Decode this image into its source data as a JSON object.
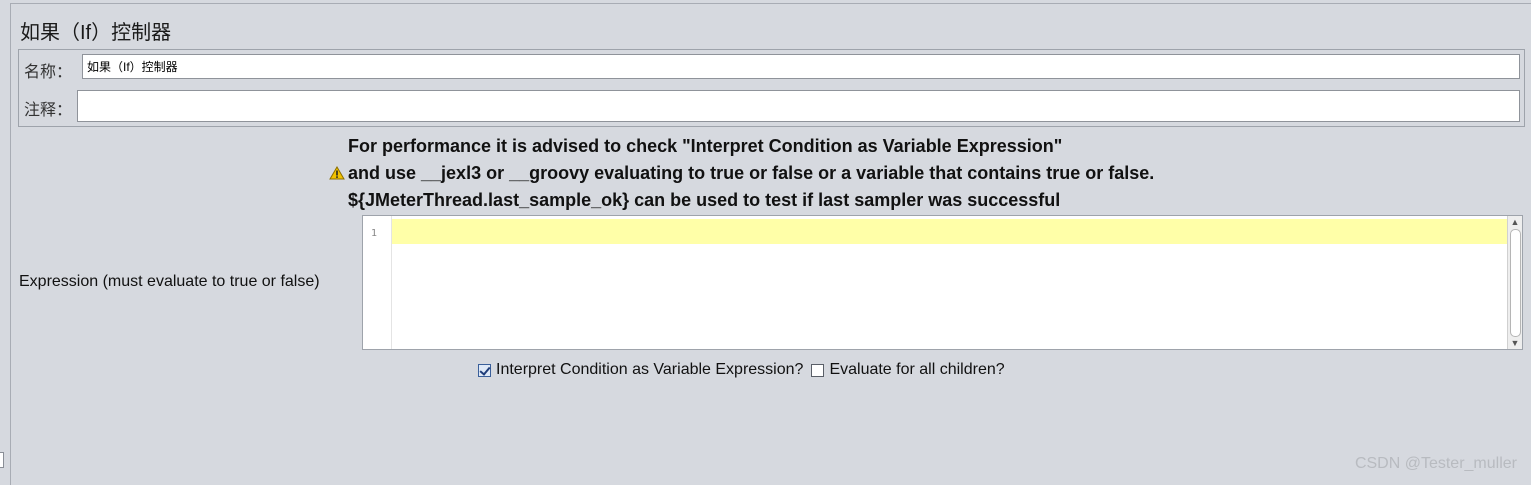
{
  "panel": {
    "title": "如果（If）控制器"
  },
  "fields": {
    "name_label": "名称：",
    "name_value": "如果（If）控制器",
    "comment_label": "注释：",
    "comment_value": ""
  },
  "warning": {
    "icon": "warning-triangle-icon",
    "line1": "For performance it is advised to check \"Interpret Condition as Variable Expression\"",
    "line2": "and use __jexl3 or __groovy evaluating to true or false or a variable that contains true or false.",
    "line3": "${JMeterThread.last_sample_ok} can be used to test if last sampler was successful"
  },
  "expression": {
    "label": "Expression (must evaluate to true or false)",
    "line_number": "1",
    "value": ""
  },
  "options": {
    "interpret_label": "Interpret Condition as Variable Expression?",
    "interpret_checked": true,
    "evaluate_all_label": "Evaluate for all children?",
    "evaluate_all_checked": false
  },
  "watermark": "CSDN @Tester_muller",
  "colors": {
    "background": "#d6d9df",
    "current_line_highlight": "#ffffa8",
    "warning_icon": "#f2c200"
  }
}
